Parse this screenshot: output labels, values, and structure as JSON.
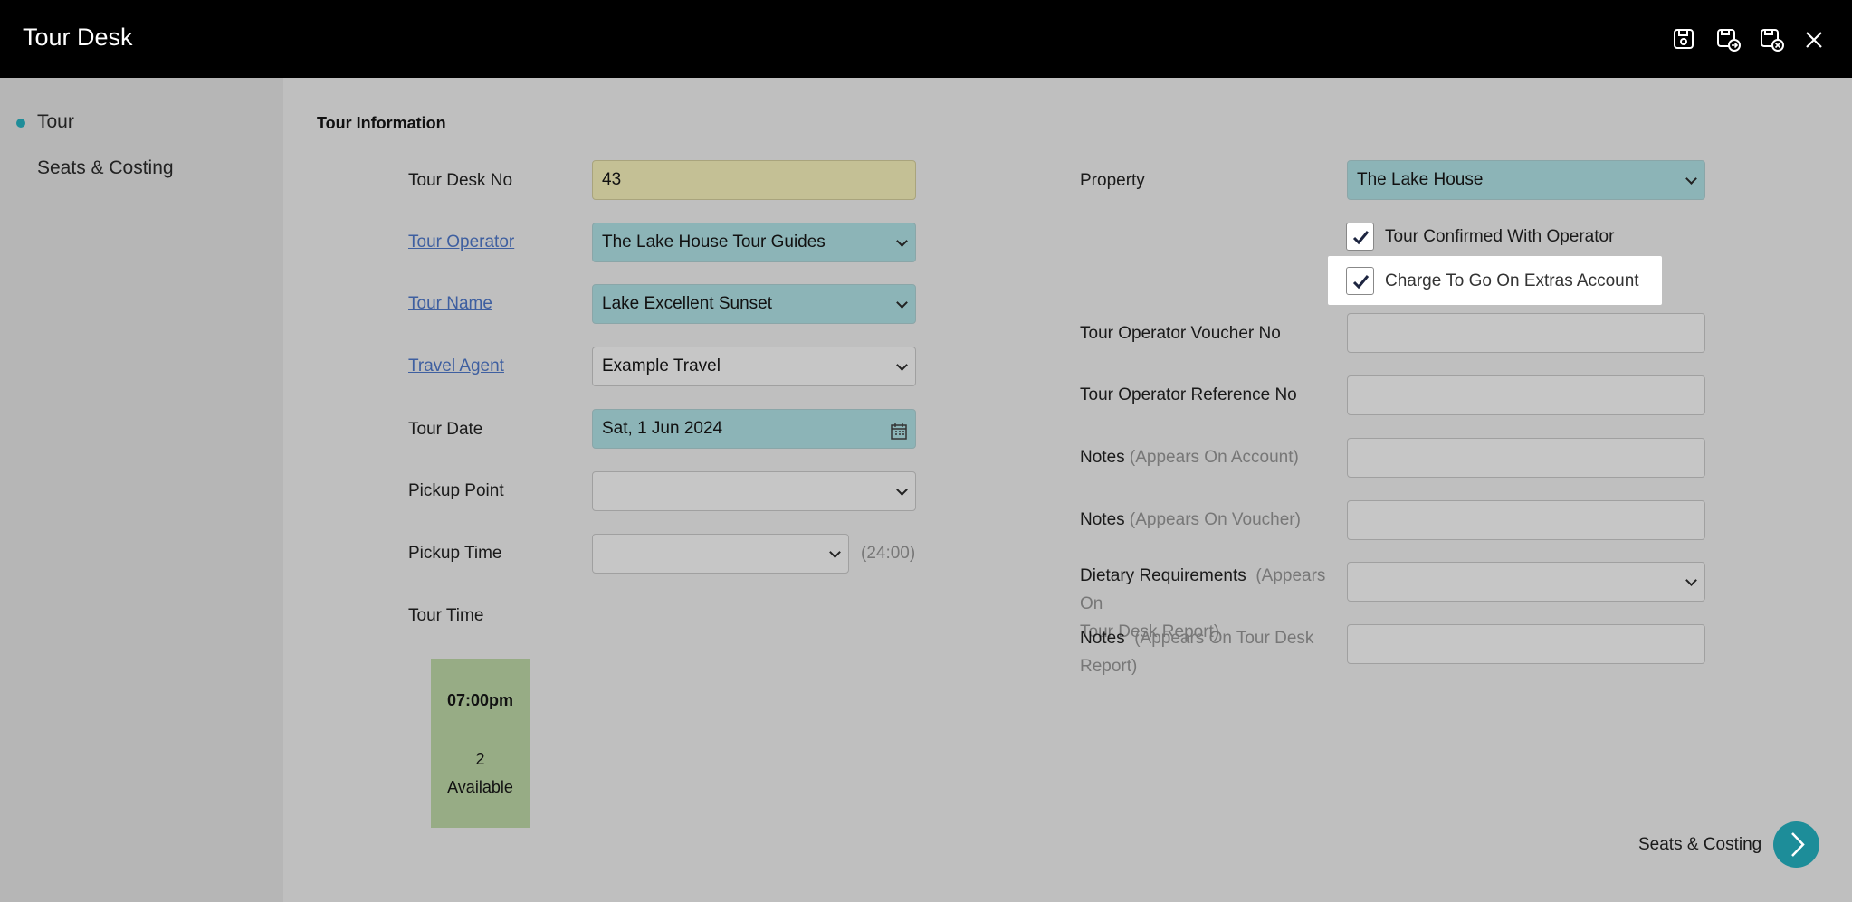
{
  "header": {
    "title": "Tour Desk",
    "icons": [
      "save-icon",
      "save-and-new-icon",
      "save-and-close-icon",
      "close-icon"
    ]
  },
  "sidebar": {
    "items": [
      {
        "label": "Tour",
        "active": true
      },
      {
        "label": "Seats & Costing",
        "active": false
      }
    ]
  },
  "main": {
    "section_title": "Tour Information",
    "left": {
      "tour_desk_no": {
        "label": "Tour Desk No",
        "value": "43"
      },
      "tour_operator": {
        "label": "Tour Operator",
        "value": "The Lake House Tour Guides"
      },
      "tour_name": {
        "label": "Tour Name",
        "value": "Lake Excellent Sunset"
      },
      "travel_agent": {
        "label": "Travel Agent",
        "value": "Example Travel"
      },
      "tour_date": {
        "label": "Tour Date",
        "value": "Sat, 1 Jun 2024"
      },
      "pickup_point": {
        "label": "Pickup Point",
        "value": ""
      },
      "pickup_time": {
        "label": "Pickup Time",
        "value": "",
        "hint": "(24:00)"
      },
      "tour_time": {
        "label": "Tour Time",
        "slot": {
          "time": "07:00pm",
          "count": "2",
          "status": "Available"
        }
      }
    },
    "right": {
      "property": {
        "label": "Property",
        "value": "The Lake House"
      },
      "tour_confirmed": {
        "label": "Tour Confirmed With Operator",
        "checked": true
      },
      "charge_extras": {
        "label": "Charge To Go On Extras Account",
        "checked": true
      },
      "voucher_no": {
        "label": "Tour Operator Voucher No",
        "value": ""
      },
      "reference_no": {
        "label": "Tour Operator Reference No",
        "value": ""
      },
      "notes_account": {
        "label": "Notes",
        "hint": "(Appears On Account)",
        "value": ""
      },
      "notes_voucher": {
        "label": "Notes",
        "hint": "(Appears On Voucher)",
        "value": ""
      },
      "dietary": {
        "label": "Dietary Requirements",
        "hint": "(Appears On",
        "hint2": "Tour Desk Report)",
        "value": ""
      },
      "notes_report": {
        "label": "Notes",
        "hint": "(Appears On Tour Desk",
        "hint2": "Report)",
        "value": ""
      }
    },
    "footer": {
      "next_label": "Seats & Costing"
    }
  },
  "colors": {
    "accent": "#1d8d99",
    "teal_field": "#8cb4b7",
    "yellow_field": "#c4c095",
    "slot": "#97ac85"
  }
}
